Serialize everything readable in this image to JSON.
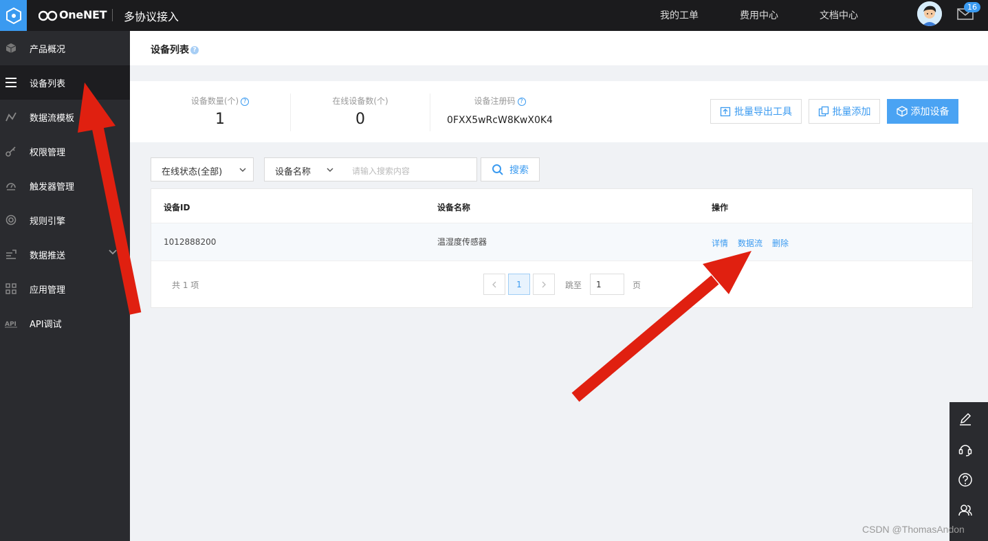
{
  "header": {
    "brand": "OneNET",
    "subtitle": "多协议接入",
    "nav": [
      "我的工单",
      "费用中心",
      "文档中心"
    ],
    "badge_count": "16"
  },
  "sidebar": {
    "items": [
      {
        "label": "产品概况",
        "icon": "cube-icon"
      },
      {
        "label": "设备列表",
        "icon": "list-icon",
        "active": true
      },
      {
        "label": "数据流模板",
        "icon": "line-chart-icon"
      },
      {
        "label": "权限管理",
        "icon": "key-icon"
      },
      {
        "label": "触发器管理",
        "icon": "gauge-icon"
      },
      {
        "label": "规则引擎",
        "icon": "target-icon"
      },
      {
        "label": "数据推送",
        "icon": "push-icon"
      },
      {
        "label": "应用管理",
        "icon": "grid-icon"
      },
      {
        "label": "API调试",
        "icon": "api-icon"
      }
    ]
  },
  "page": {
    "title": "设备列表"
  },
  "stats": {
    "device_count_label": "设备数量(个)",
    "device_count": "1",
    "online_count_label": "在线设备数(个)",
    "online_count": "0",
    "reg_code_label": "设备注册码",
    "reg_code": "0FXX5wRcW8KwX0K4"
  },
  "actions": {
    "export": "批量导出工具",
    "batch_add": "批量添加",
    "add_device": "添加设备"
  },
  "filters": {
    "status": "在线状态(全部)",
    "field": "设备名称",
    "search_placeholder": "请输入搜索内容",
    "search_button": "搜索"
  },
  "table": {
    "headers": [
      "设备ID",
      "设备名称",
      "操作"
    ],
    "rows": [
      {
        "id": "1012888200",
        "name": "温湿度传感器",
        "actions": [
          "详情",
          "数据流",
          "删除"
        ]
      }
    ]
  },
  "pager": {
    "total": "共 1 项",
    "current": "1",
    "jump_label": "跳至",
    "jump_value": "1",
    "page_suffix": "页"
  },
  "watermark": "CSDN @ThomasAndon",
  "colors": {
    "accent": "#3a9af0",
    "sidebar": "#2a2b2f",
    "topbar": "#1b1b1d",
    "arrow": "#e02010"
  }
}
